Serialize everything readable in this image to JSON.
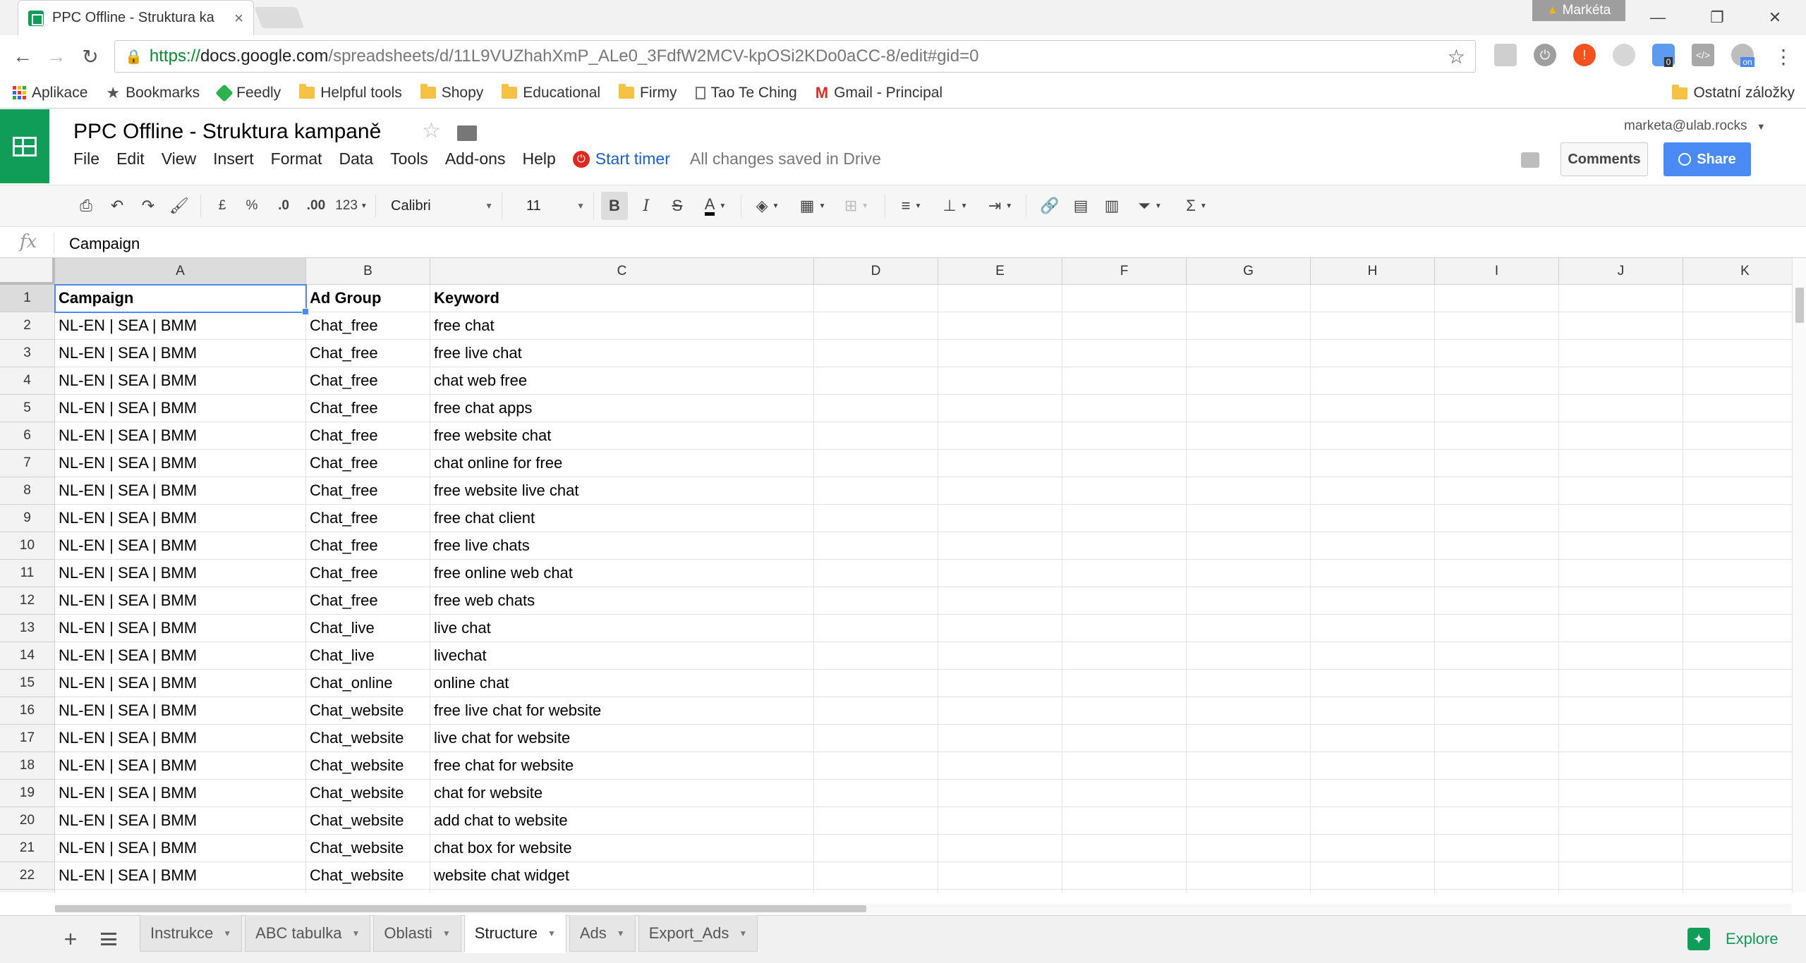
{
  "browser": {
    "tab_title": "PPC Offline - Struktura ka",
    "tab_close": "×",
    "profile_name": "Markéta",
    "address": {
      "scheme": "https://",
      "host": "docs.google.com",
      "path": "/spreadsheets/d/11L9VUZhahXmP_ALe0_3FdfW2MCV-kpOSi2KDo0aCC-8/edit#gid=0"
    },
    "bookmarks": [
      {
        "label": "Aplikace",
        "icon": "apps-grid-icon"
      },
      {
        "label": "Bookmarks",
        "icon": "star-icon"
      },
      {
        "label": "Feedly",
        "icon": "feedly-icon"
      },
      {
        "label": "Helpful tools",
        "icon": "folder-icon"
      },
      {
        "label": "Shopy",
        "icon": "folder-icon"
      },
      {
        "label": "Educational",
        "icon": "folder-icon"
      },
      {
        "label": "Firmy",
        "icon": "folder-icon"
      },
      {
        "label": "Tao Te Ching",
        "icon": "page-icon"
      },
      {
        "label": "Gmail - Principal",
        "icon": "gmail-icon"
      }
    ],
    "other_bookmarks": "Ostatní záložky",
    "extension_badge": "0",
    "extension_on": "on"
  },
  "doc": {
    "title": "PPC Offline - Struktura kampaně",
    "menu": [
      "File",
      "Edit",
      "View",
      "Insert",
      "Format",
      "Data",
      "Tools",
      "Add-ons",
      "Help"
    ],
    "timer_label": "Start timer",
    "save_status": "All changes saved in Drive",
    "user_email": "marketa@ulab.rocks",
    "comments_label": "Comments",
    "share_label": "Share"
  },
  "toolbar": {
    "currency": "£",
    "percent": "%",
    "dec_less": ".0",
    "dec_more": ".00",
    "more_formats": "123",
    "font": "Calibri",
    "font_size": "11",
    "bold": "B",
    "italic": "I",
    "strike": "S",
    "text_color": "A",
    "sum": "Σ"
  },
  "formula_bar": {
    "fx": "fx",
    "value": "Campaign"
  },
  "grid": {
    "columns": [
      "A",
      "B",
      "C",
      "D",
      "E",
      "F",
      "G",
      "H",
      "I",
      "J",
      "K"
    ],
    "rows": [
      [
        "Campaign",
        "Ad Group",
        "Keyword"
      ],
      [
        "NL-EN | SEA | BMM",
        "Chat_free",
        "free chat"
      ],
      [
        "NL-EN | SEA | BMM",
        "Chat_free",
        "free live chat"
      ],
      [
        "NL-EN | SEA | BMM",
        "Chat_free",
        "chat web free"
      ],
      [
        "NL-EN | SEA | BMM",
        "Chat_free",
        "free chat apps"
      ],
      [
        "NL-EN | SEA | BMM",
        "Chat_free",
        "free website chat"
      ],
      [
        "NL-EN | SEA | BMM",
        "Chat_free",
        "chat online for free"
      ],
      [
        "NL-EN | SEA | BMM",
        "Chat_free",
        "free website live chat"
      ],
      [
        "NL-EN | SEA | BMM",
        "Chat_free",
        "free chat client"
      ],
      [
        "NL-EN | SEA | BMM",
        "Chat_free",
        "free live chats"
      ],
      [
        "NL-EN | SEA | BMM",
        "Chat_free",
        "free online web chat"
      ],
      [
        "NL-EN | SEA | BMM",
        "Chat_free",
        "free web chats"
      ],
      [
        "NL-EN | SEA | BMM",
        "Chat_live",
        "live chat"
      ],
      [
        "NL-EN | SEA | BMM",
        "Chat_live",
        "livechat"
      ],
      [
        "NL-EN | SEA | BMM",
        "Chat_online",
        "online chat"
      ],
      [
        "NL-EN | SEA | BMM",
        "Chat_website",
        "free live chat for website"
      ],
      [
        "NL-EN | SEA | BMM",
        "Chat_website",
        "live chat for website"
      ],
      [
        "NL-EN | SEA | BMM",
        "Chat_website",
        "free chat for website"
      ],
      [
        "NL-EN | SEA | BMM",
        "Chat_website",
        "chat for website"
      ],
      [
        "NL-EN | SEA | BMM",
        "Chat_website",
        "add chat to website"
      ],
      [
        "NL-EN | SEA | BMM",
        "Chat_website",
        "chat box for website"
      ],
      [
        "NL-EN | SEA | BMM",
        "Chat_website",
        "website chat widget"
      ],
      [
        "",
        "",
        ""
      ]
    ]
  },
  "sheets": {
    "tabs": [
      "Instrukce",
      "ABC tabulka",
      "Oblasti",
      "Structure",
      "Ads",
      "Export_Ads"
    ],
    "active": "Structure",
    "explore_label": "Explore"
  },
  "colors": {
    "sheets_green": "#0f9d58",
    "share_blue": "#4a8af4",
    "selection_blue": "#4a8af4",
    "timer_red": "#e0281d"
  }
}
